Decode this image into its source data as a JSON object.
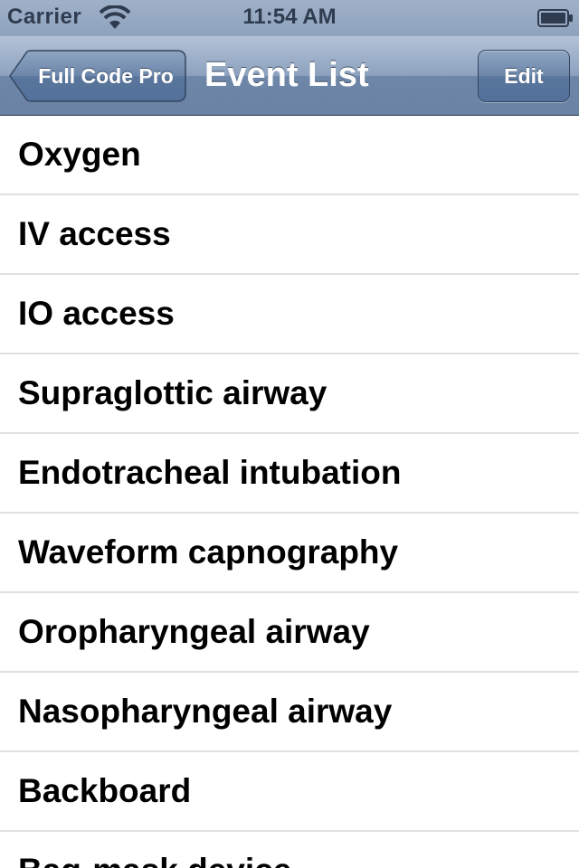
{
  "status_bar": {
    "carrier": "Carrier",
    "time": "11:54 AM",
    "icons": [
      "wifi-icon",
      "battery-icon"
    ]
  },
  "nav": {
    "back_label": "Full Code Pro",
    "title": "Event List",
    "edit_label": "Edit"
  },
  "events": [
    "Oxygen",
    "IV access",
    "IO access",
    "Supraglottic airway",
    "Endotracheal intubation",
    "Waveform capnography",
    "Oropharyngeal airway",
    "Nasopharyngeal airway",
    "Backboard",
    "Bag-mask device"
  ],
  "colors": {
    "nav_bar": "#6e87a8",
    "separator": "#e0e0e0",
    "text": "#000000"
  }
}
